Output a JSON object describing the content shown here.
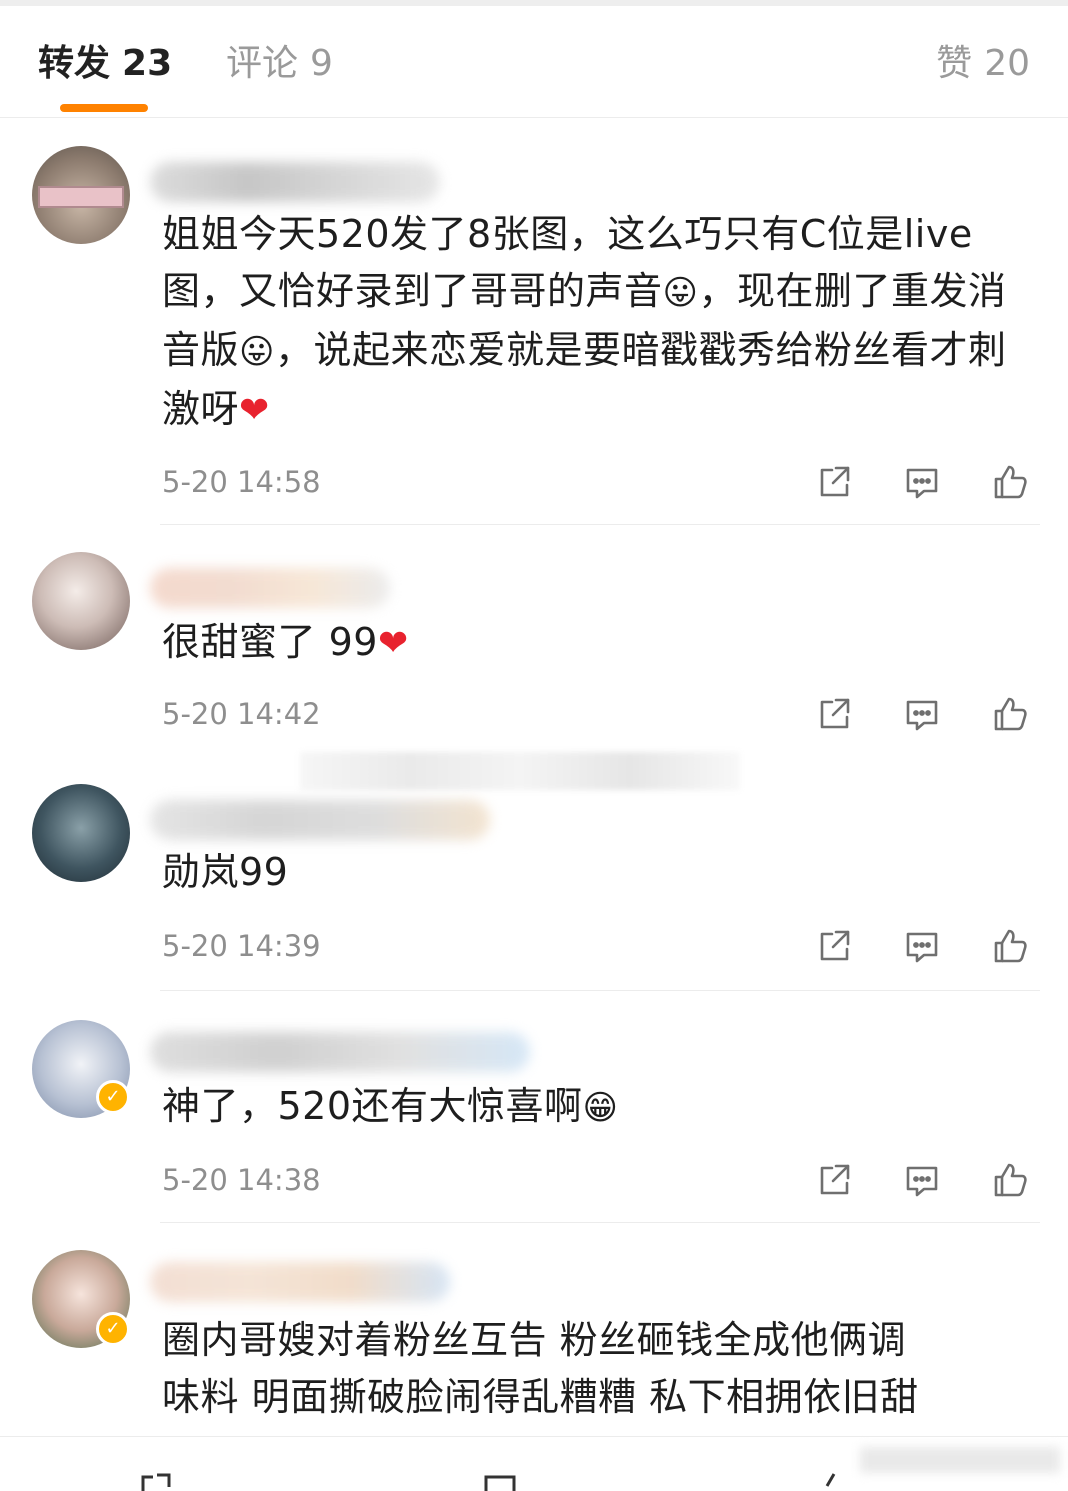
{
  "tabs": {
    "repost": {
      "label": "转发",
      "count": "23"
    },
    "comment": {
      "label": "评论",
      "count": "9"
    },
    "like": {
      "label": "赞",
      "count": "20"
    }
  },
  "comments": [
    {
      "content": "姐姐今天520发了8张图，这么巧只有C位是live图，又恰好录到了哥哥的声音",
      "content_2": "，现在删了重发消音版",
      "content_3": "，说起来恋爱就是要暗戳戳秀给粉丝看才刺激呀",
      "time": "5-20 14:58"
    },
    {
      "content": "很甜蜜了 99",
      "time": "5-20 14:42"
    },
    {
      "content": "勋岚99",
      "time": "5-20 14:39"
    },
    {
      "content": "神了，520还有大惊喜啊",
      "time": "5-20 14:38"
    },
    {
      "content_line1": "圈内哥嫂对着粉丝互告 粉丝砸钱全成他俩调",
      "content_line2": "味料 明面撕破脸闹得乱糟糟 私下相拥依旧甜"
    }
  ],
  "icons": {
    "share": "share-icon",
    "comment": "comment-icon",
    "like": "thumbs-up-icon"
  },
  "colors": {
    "accent": "#ff8200",
    "heart": "#e8222e",
    "muted": "#8e8e8e"
  }
}
